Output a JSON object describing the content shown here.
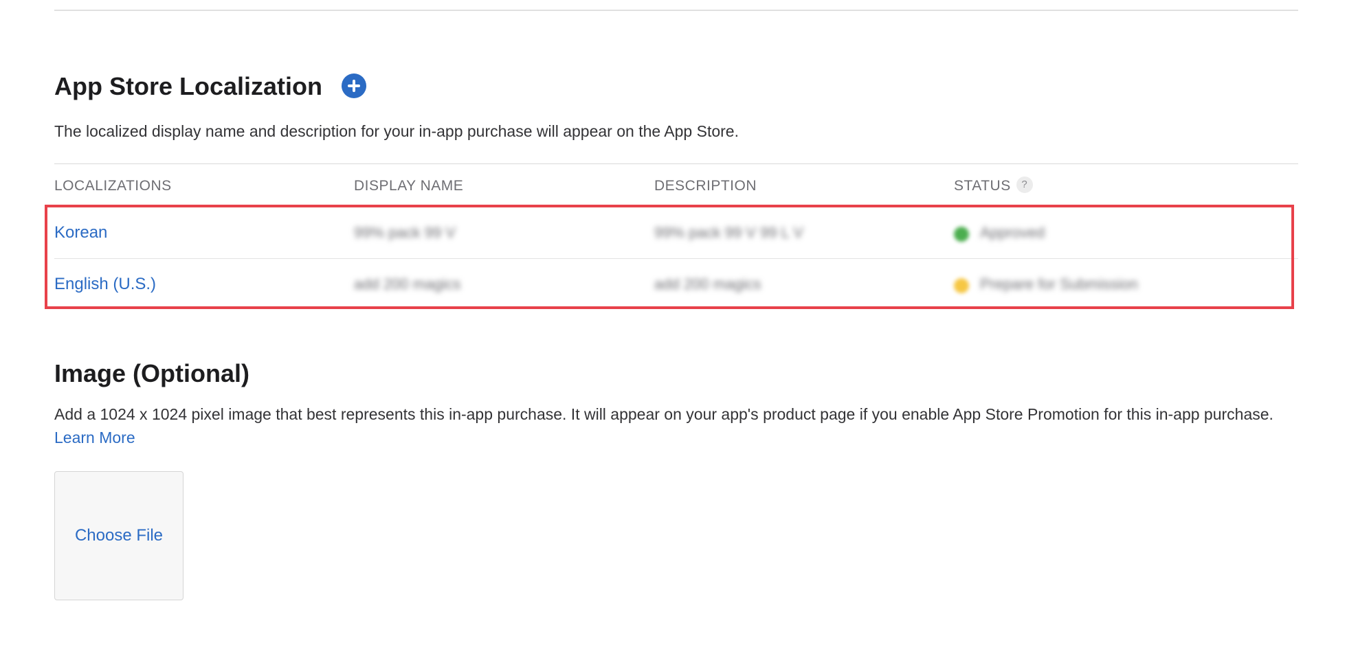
{
  "localization_section": {
    "title": "App Store Localization",
    "add_icon": "plus-circle-icon",
    "description": "The localized display name and description for your in-app purchase will appear on the App Store.",
    "columns": {
      "localizations": "LOCALIZATIONS",
      "display_name": "DISPLAY NAME",
      "description": "DESCRIPTION",
      "status": "STATUS",
      "status_help": "?"
    },
    "rows": [
      {
        "localization": "Korean",
        "display_name": "99% pack 99 V",
        "description": "99% pack 99 V 99 L V",
        "status": "Approved",
        "status_color": "#4cae4f"
      },
      {
        "localization": "English (U.S.)",
        "display_name": "add 200 magics",
        "description": "add 200 magics",
        "status": "Prepare for Submission",
        "status_color": "#f6c744"
      }
    ]
  },
  "image_section": {
    "title": "Image (Optional)",
    "description": "Add a 1024 x 1024 pixel image that best represents this in-app purchase. It will appear on your app's product page if you enable App Store Promotion for this in-app purchase.",
    "learn_more": "Learn More",
    "choose_file": "Choose File"
  },
  "colors": {
    "accent": "#2b6bc4",
    "highlight_border": "#e8414a"
  }
}
